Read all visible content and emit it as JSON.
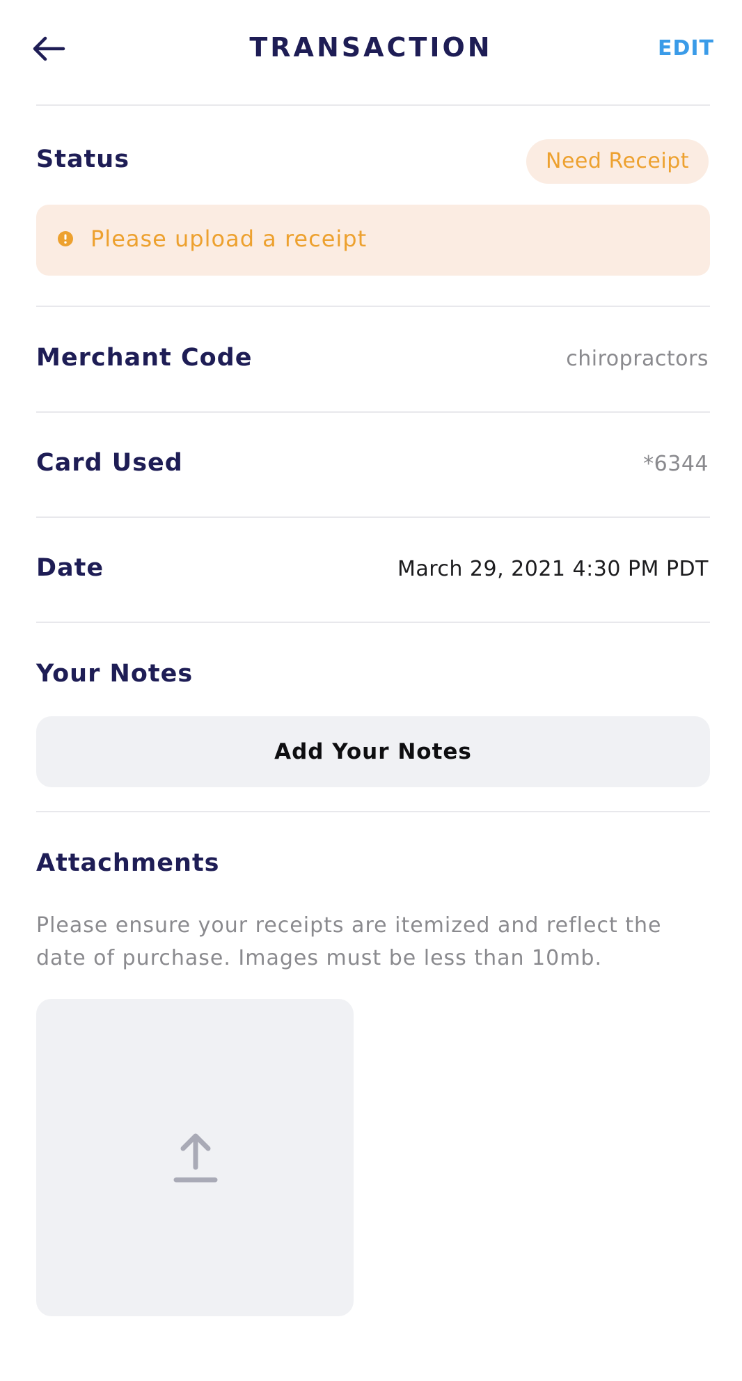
{
  "header": {
    "title": "TRANSACTION",
    "edit_label": "EDIT",
    "back_icon": "arrow-left-icon"
  },
  "status": {
    "label": "Status",
    "badge": "Need Receipt",
    "alert_text": "Please upload a receipt",
    "alert_icon": "exclamation-circle-icon",
    "accent_color": "#eda12f"
  },
  "merchant_code": {
    "label": "Merchant Code",
    "value": "chiropractors"
  },
  "card_used": {
    "label": "Card Used",
    "value": "*6344"
  },
  "date": {
    "label": "Date",
    "value": "March 29, 2021 4:30 PM PDT"
  },
  "notes": {
    "label": "Your Notes",
    "button_label": "Add Your Notes"
  },
  "attachments": {
    "label": "Attachments",
    "description": "Please ensure your receipts are itemized and reflect the date of purchase. Images must be less than 10mb.",
    "upload_icon": "upload-icon"
  },
  "colors": {
    "heading": "#1e1d55",
    "link": "#3a9be8",
    "warning": "#eda12f",
    "warning_bg": "#fbece2",
    "muted": "#8a8a8e"
  }
}
